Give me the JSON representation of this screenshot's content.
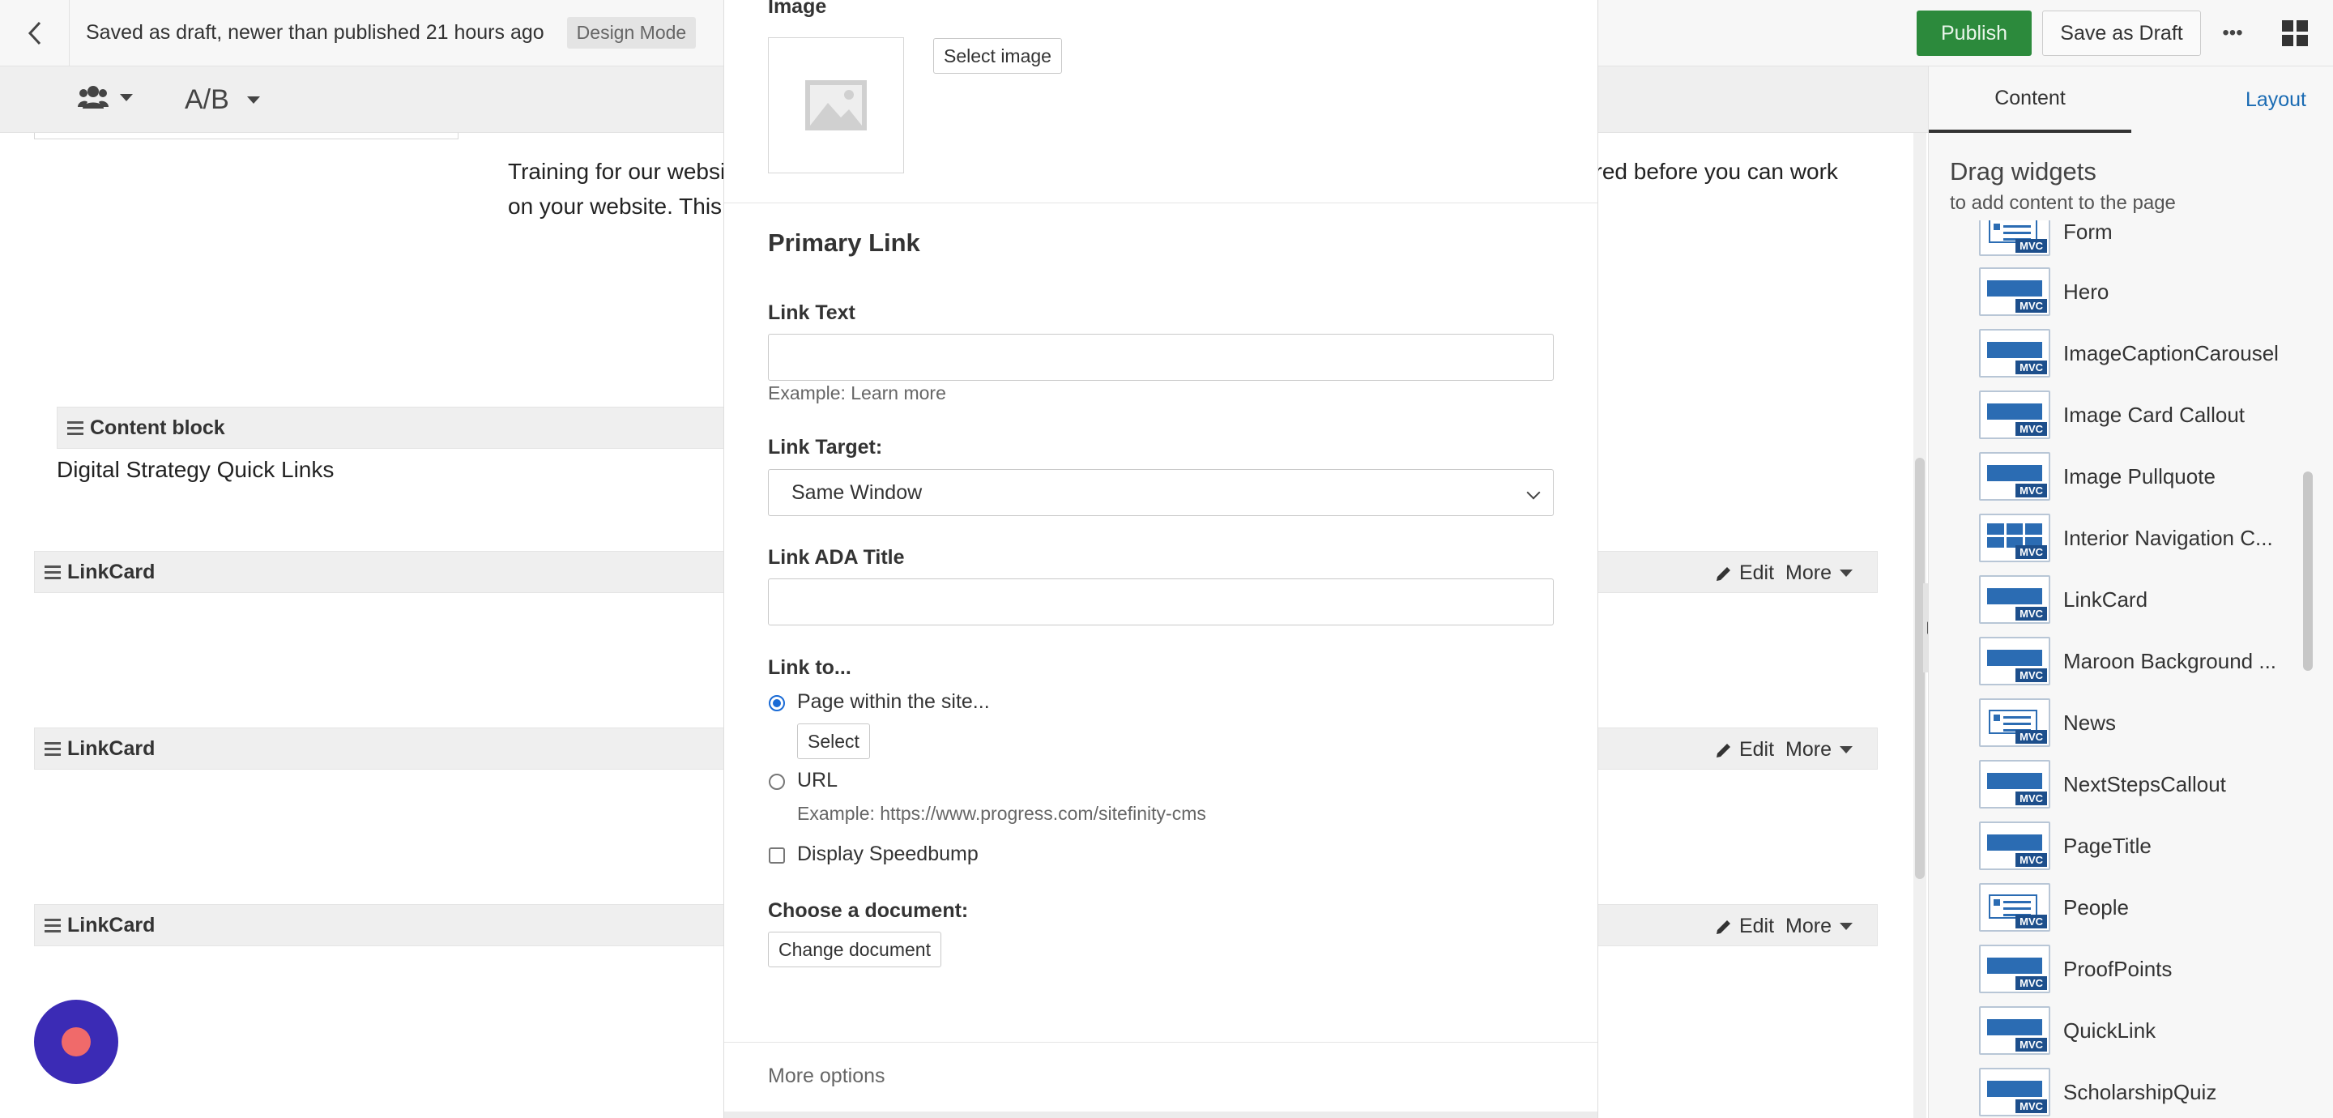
{
  "topbar": {
    "status": "Saved as draft, newer than published 21 hours ago",
    "mode_badge": "Design Mode",
    "publish_label": "Publish",
    "save_draft_label": "Save as Draft",
    "more_label": "•••"
  },
  "subbar": {
    "ab_label": "A/B"
  },
  "canvas": {
    "training_text": "Training for our website (Sitefinity) is required for all new editors and collaborators. The collaborators is required before you can work on your website. This training covers basic editing skills using images, documents, forms, and more.",
    "content_block_label": "Content block",
    "quick_links_text": "Digital Strategy Quick Links",
    "linkcard_label": "LinkCard",
    "edit_label": "Edit",
    "more_label": "More"
  },
  "modal": {
    "image_heading": "Image",
    "select_image_label": "Select image",
    "primary_link_title": "Primary Link",
    "link_text_label": "Link Text",
    "link_text_value": "",
    "link_text_hint": "Example: Learn more",
    "link_target_label": "Link Target:",
    "link_target_value": "Same Window",
    "link_ada_label": "Link ADA Title",
    "link_ada_value": "",
    "link_to_label": "Link to...",
    "option_page": "Page within the site...",
    "select_label": "Select",
    "option_url": "URL",
    "url_hint": "Example: https://www.progress.com/sitefinity-cms",
    "speedbump_label": "Display Speedbump",
    "choose_doc_label": "Choose a document:",
    "change_doc_label": "Change document",
    "more_options_label": "More options"
  },
  "panel": {
    "tab_content": "Content",
    "tab_layout": "Layout",
    "drag_title": "Drag widgets",
    "drag_sub": "to add content to the page",
    "mvc_badge": "MVC",
    "widgets": [
      "Form",
      "Hero",
      "ImageCaptionCarousel",
      "Image Card Callout",
      "Image Pullquote",
      "Interior Navigation C...",
      "LinkCard",
      "Maroon Background ...",
      "News",
      "NextStepsCallout",
      "PageTitle",
      "People",
      "ProofPoints",
      "QuickLink",
      "ScholarshipQuiz"
    ]
  },
  "colors": {
    "publish": "#2c8a3c",
    "accent_link": "#1a6bb3",
    "widget_blue": "#2b6cb3",
    "record_button": "#3b2bb5"
  }
}
